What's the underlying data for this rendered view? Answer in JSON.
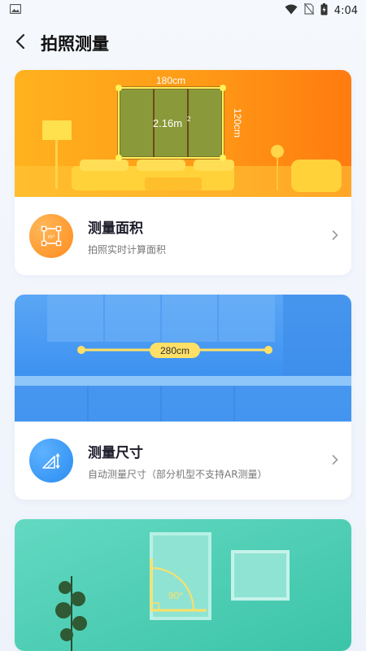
{
  "status_bar": {
    "time": "4:04",
    "icons": [
      "image-icon",
      "wifi-icon",
      "no-sim-icon",
      "battery-icon"
    ]
  },
  "header": {
    "title": "拍照测量",
    "back_icon": "chevron-left-icon"
  },
  "cards": [
    {
      "title": "测量面积",
      "subtitle": "拍照实时计算面积",
      "icon": "area-frame-icon",
      "color": "#ff8a1c",
      "image": {
        "width_label": "180cm",
        "height_label": "120cm",
        "area_label": "2.16m",
        "area_sup": "2"
      }
    },
    {
      "title": "测量尺寸",
      "subtitle": "自动测量尺寸（部分机型不支持AR测量）",
      "icon": "ruler-triangle-icon",
      "color": "#2a8cf0",
      "image": {
        "length_label": "280cm"
      }
    },
    {
      "title": "",
      "subtitle": "",
      "color": "#4fcfb5",
      "image": {
        "angle_label": "90°"
      }
    }
  ]
}
